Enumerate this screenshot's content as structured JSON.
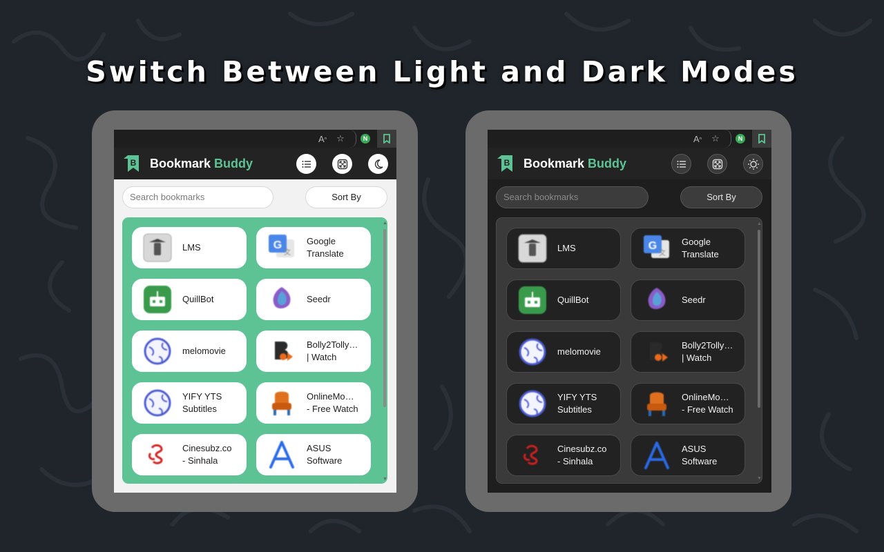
{
  "title": "Switch Between Light and Dark Modes",
  "colors": {
    "accent": "#5ec394",
    "background": "#20252b",
    "frame": "#6b6b6b"
  },
  "browser_bar": {
    "icons": [
      "read-aloud-icon",
      "favorite-star-icon",
      "extension-n-icon",
      "bookmark-buddy-extension-icon"
    ],
    "n_label": "N"
  },
  "app": {
    "brand_main": "Bookmark",
    "brand_accent": "Buddy",
    "search_placeholder": "Search bookmarks",
    "sort_label": "Sort By",
    "light_theme_toggle_icon": "moon-icon",
    "dark_theme_toggle_icon": "sun-icon"
  },
  "bookmarks": [
    {
      "label": "LMS",
      "icon": "lms-icon"
    },
    {
      "label": "Google\nTranslate",
      "icon": "google-translate-icon"
    },
    {
      "label": "QuillBot",
      "icon": "quillbot-icon"
    },
    {
      "label": "Seedr",
      "icon": "seedr-icon"
    },
    {
      "label": "melomovie",
      "icon": "globe-icon"
    },
    {
      "label": "Bolly2Tolly…\n| Watch",
      "icon": "bolly2tolly-icon"
    },
    {
      "label": "YIFY YTS\nSubtitles",
      "icon": "globe-icon"
    },
    {
      "label": "OnlineMo…\n- Free Watch",
      "icon": "onlinemovies-icon"
    },
    {
      "label": "Cinesubz.co\n- Sinhala",
      "icon": "cinesubz-icon"
    },
    {
      "label": "ASUS\nSoftware",
      "icon": "asus-icon"
    }
  ]
}
